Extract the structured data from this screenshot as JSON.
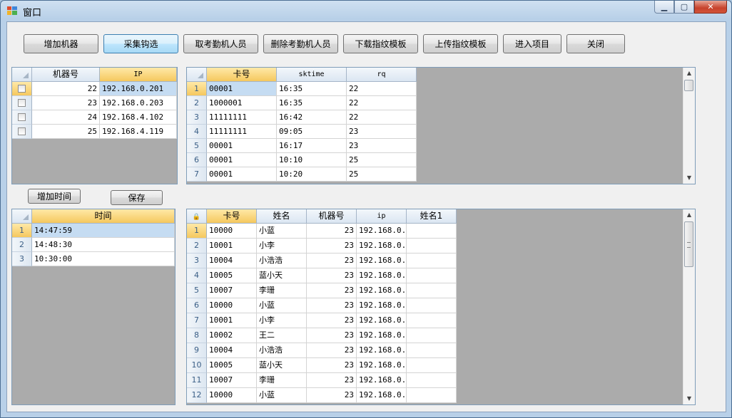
{
  "window": {
    "title": "窗口",
    "icon": "app-window-icon"
  },
  "toolbar": {
    "buttons": [
      "增加机器",
      "采集钩选",
      "取考勤机人员",
      "删除考勤机人员",
      "下载指纹模板",
      "上传指纹模板",
      "进入项目",
      "关闭"
    ]
  },
  "machines": {
    "headers": [
      "机器号",
      "IP"
    ],
    "rows": [
      {
        "no": "22",
        "ip": "192.168.0.201"
      },
      {
        "no": "23",
        "ip": "192.168.0.203"
      },
      {
        "no": "24",
        "ip": "192.168.4.102"
      },
      {
        "no": "25",
        "ip": "192.168.4.119"
      }
    ]
  },
  "records": {
    "headers": [
      "卡号",
      "sktime",
      "rq"
    ],
    "rows": [
      {
        "n": "1",
        "card": "00001",
        "time": "16:35",
        "rq": "22"
      },
      {
        "n": "2",
        "card": "1000001",
        "time": "16:35",
        "rq": "22"
      },
      {
        "n": "3",
        "card": "11111111",
        "time": "16:42",
        "rq": "22"
      },
      {
        "n": "4",
        "card": "11111111",
        "time": "09:05",
        "rq": "23"
      },
      {
        "n": "5",
        "card": "00001",
        "time": "16:17",
        "rq": "23"
      },
      {
        "n": "6",
        "card": "00001",
        "time": "10:10",
        "rq": "25"
      },
      {
        "n": "7",
        "card": "00001",
        "time": "10:20",
        "rq": "25"
      }
    ]
  },
  "time_buttons": {
    "add": "增加时间",
    "save": "保存"
  },
  "times": {
    "header": "时间",
    "rows": [
      {
        "n": "1",
        "t": "14:47:59"
      },
      {
        "n": "2",
        "t": "14:48:30"
      },
      {
        "n": "3",
        "t": "10:30:00"
      }
    ]
  },
  "people": {
    "headers": [
      "卡号",
      "姓名",
      "机器号",
      "ip",
      "姓名1"
    ],
    "rows": [
      {
        "n": "1",
        "card": "10000",
        "name": "小蓝",
        "mno": "23",
        "ip": "192.168.0."
      },
      {
        "n": "2",
        "card": "10001",
        "name": "小李",
        "mno": "23",
        "ip": "192.168.0."
      },
      {
        "n": "3",
        "card": "10004",
        "name": "小浩浩",
        "mno": "23",
        "ip": "192.168.0."
      },
      {
        "n": "4",
        "card": "10005",
        "name": "蓝小天",
        "mno": "23",
        "ip": "192.168.0."
      },
      {
        "n": "5",
        "card": "10007",
        "name": "李珊",
        "mno": "23",
        "ip": "192.168.0."
      },
      {
        "n": "6",
        "card": "10000",
        "name": "小蓝",
        "mno": "23",
        "ip": "192.168.0."
      },
      {
        "n": "7",
        "card": "10001",
        "name": "小李",
        "mno": "23",
        "ip": "192.168.0."
      },
      {
        "n": "8",
        "card": "10002",
        "name": "王二",
        "mno": "23",
        "ip": "192.168.0."
      },
      {
        "n": "9",
        "card": "10004",
        "name": "小浩浩",
        "mno": "23",
        "ip": "192.168.0."
      },
      {
        "n": "10",
        "card": "10005",
        "name": "蓝小天",
        "mno": "23",
        "ip": "192.168.0."
      },
      {
        "n": "11",
        "card": "10007",
        "name": "李珊",
        "mno": "23",
        "ip": "192.168.0."
      },
      {
        "n": "12",
        "card": "10000",
        "name": "小蓝",
        "mno": "23",
        "ip": "192.168.0."
      }
    ]
  }
}
